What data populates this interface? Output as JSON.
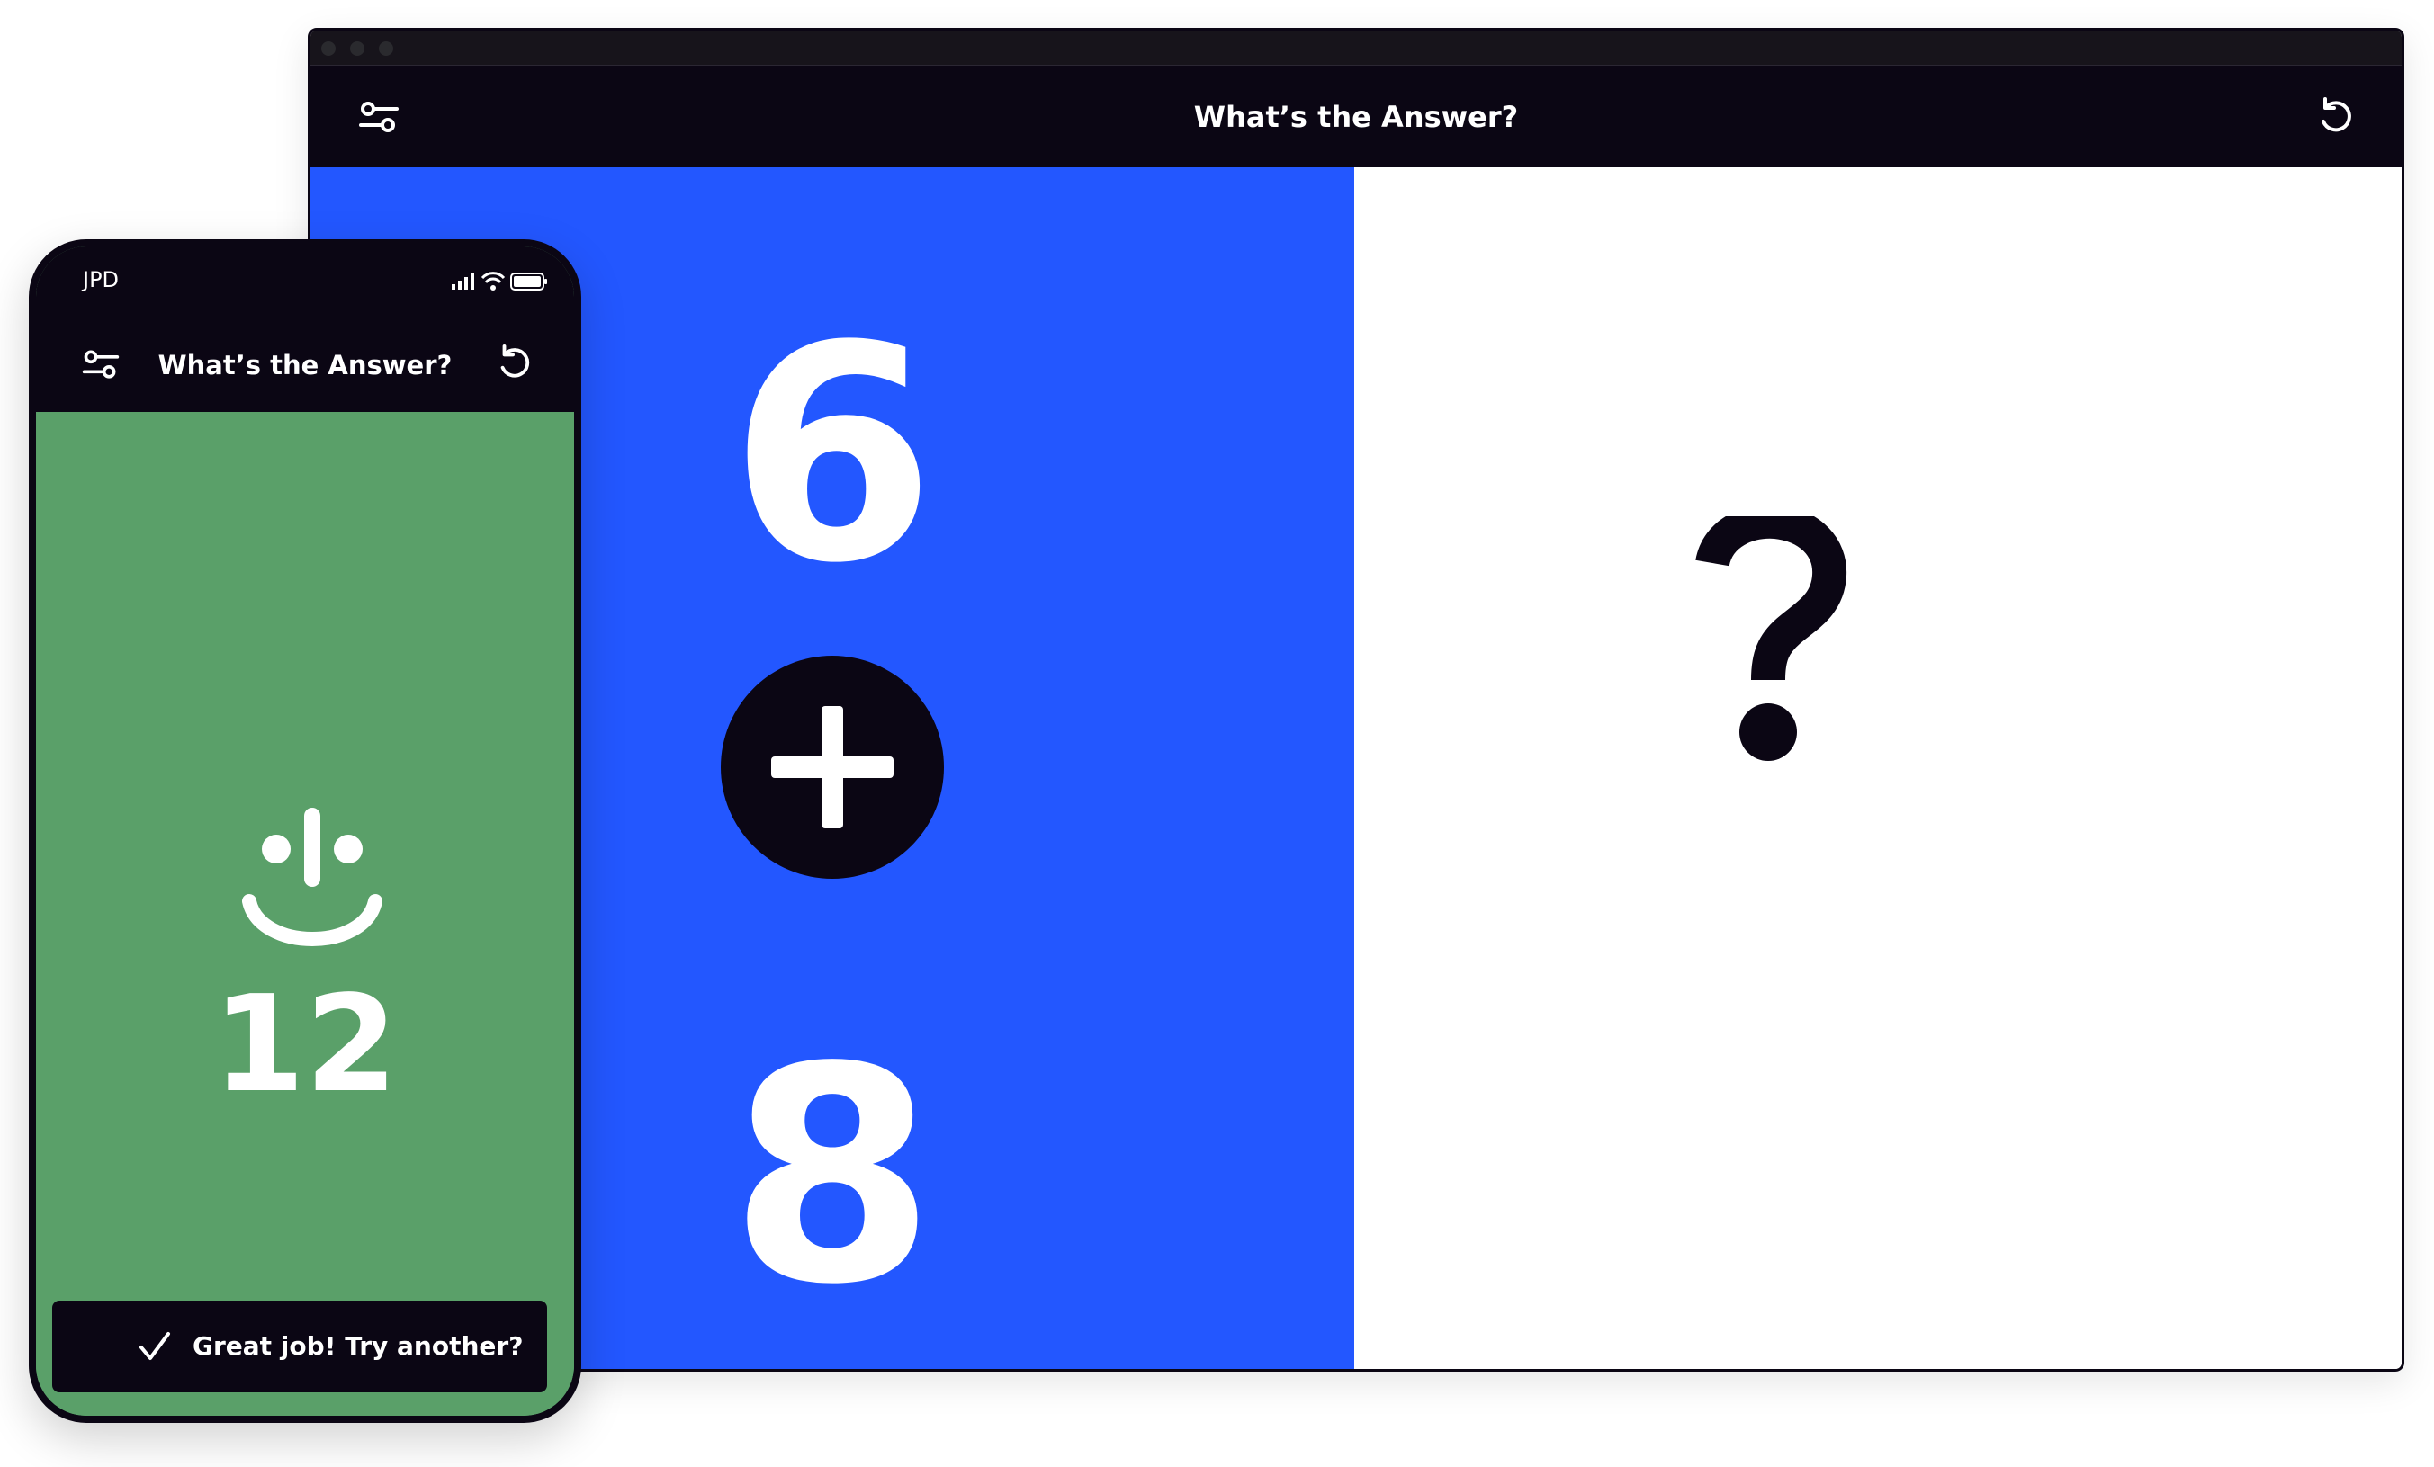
{
  "desktop": {
    "header": {
      "title": "What’s the Answer?",
      "left_icon": "settings-sliders-icon",
      "right_icon": "reset-icon"
    },
    "problem": {
      "operand_top": "6",
      "operator_icon": "plus-icon",
      "operand_bottom": "8"
    },
    "answer_panel": {
      "icon": "question-mark-icon"
    },
    "colors": {
      "header_bg": "#0b0614",
      "problem_bg": "#2357ff",
      "answer_bg": "#ffffff"
    }
  },
  "phone": {
    "status_bar": {
      "carrier": "JPD",
      "icons": [
        "signal-icon",
        "wifi-icon",
        "battery-icon"
      ]
    },
    "header": {
      "title": "What’s the Answer?",
      "left_icon": "settings-sliders-icon",
      "right_icon": "reset-icon"
    },
    "result": {
      "icon": "smiley-icon",
      "value": "12"
    },
    "feedback_button": {
      "icon": "checkmark-icon",
      "label": "Great job! Try another?"
    },
    "colors": {
      "success_bg": "#5aa069"
    }
  }
}
